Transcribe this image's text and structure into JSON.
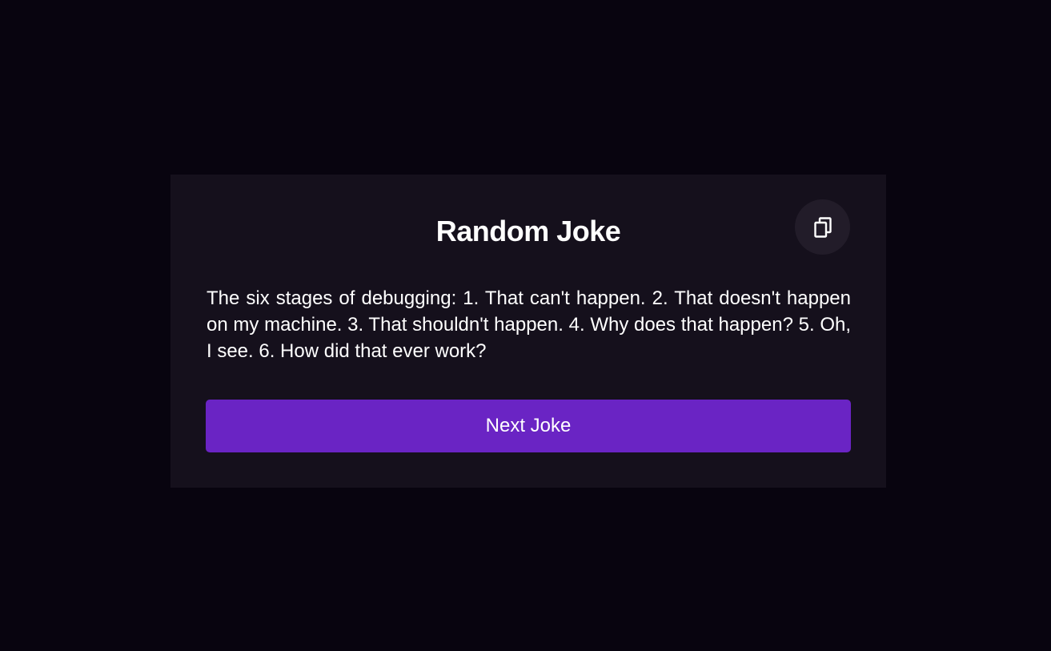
{
  "card": {
    "title": "Random Joke",
    "copy_icon": "copy-icon",
    "joke": "The six stages of debugging: 1. That can't happen. 2. That doesn't happen on my machine. 3. That shouldn't happen. 4. Why does that happen? 5. Oh, I see. 6. How did that ever work?",
    "next_button_label": "Next Joke"
  },
  "colors": {
    "page_background": "#08040f",
    "card_background": "#15101c",
    "copy_button_background": "#221c29",
    "accent": "#6a24c4",
    "text": "#ffffff"
  }
}
